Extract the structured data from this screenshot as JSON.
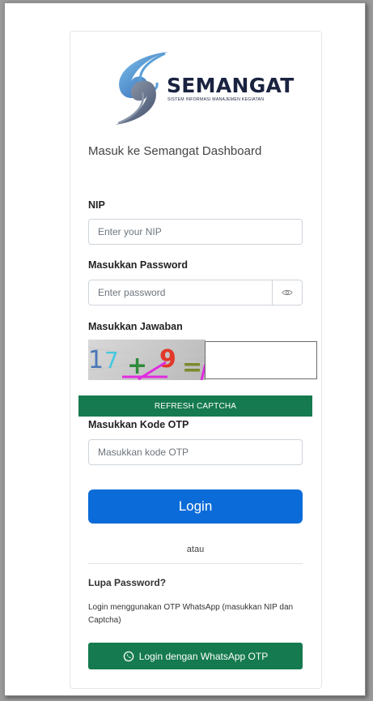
{
  "brand": {
    "name": "SEMANGAT",
    "tagline": "SISTEM INFORMASI MANAJEMEN KEGIATAN"
  },
  "headline": "Masuk ke Semangat Dashboard",
  "form": {
    "nip": {
      "label": "NIP",
      "placeholder": "Enter your NIP"
    },
    "password": {
      "label": "Masukkan Password",
      "placeholder": "Enter password"
    },
    "captcha": {
      "label": "Masukkan Jawaban",
      "refresh_label": "REFRESH CAPTCHA"
    },
    "otp": {
      "label": "Masukkan Kode OTP",
      "placeholder": "Masukkan kode OTP"
    },
    "login_label": "Login"
  },
  "divider_text": "atau",
  "forgot_password": "Lupa Password?",
  "otp_info": "Login menggunakan OTP WhatsApp (masukkan NIP dan Captcha)",
  "whatsapp_button": "Login dengan WhatsApp OTP",
  "colors": {
    "primary": "#0b6cd9",
    "success": "#157a4f"
  }
}
